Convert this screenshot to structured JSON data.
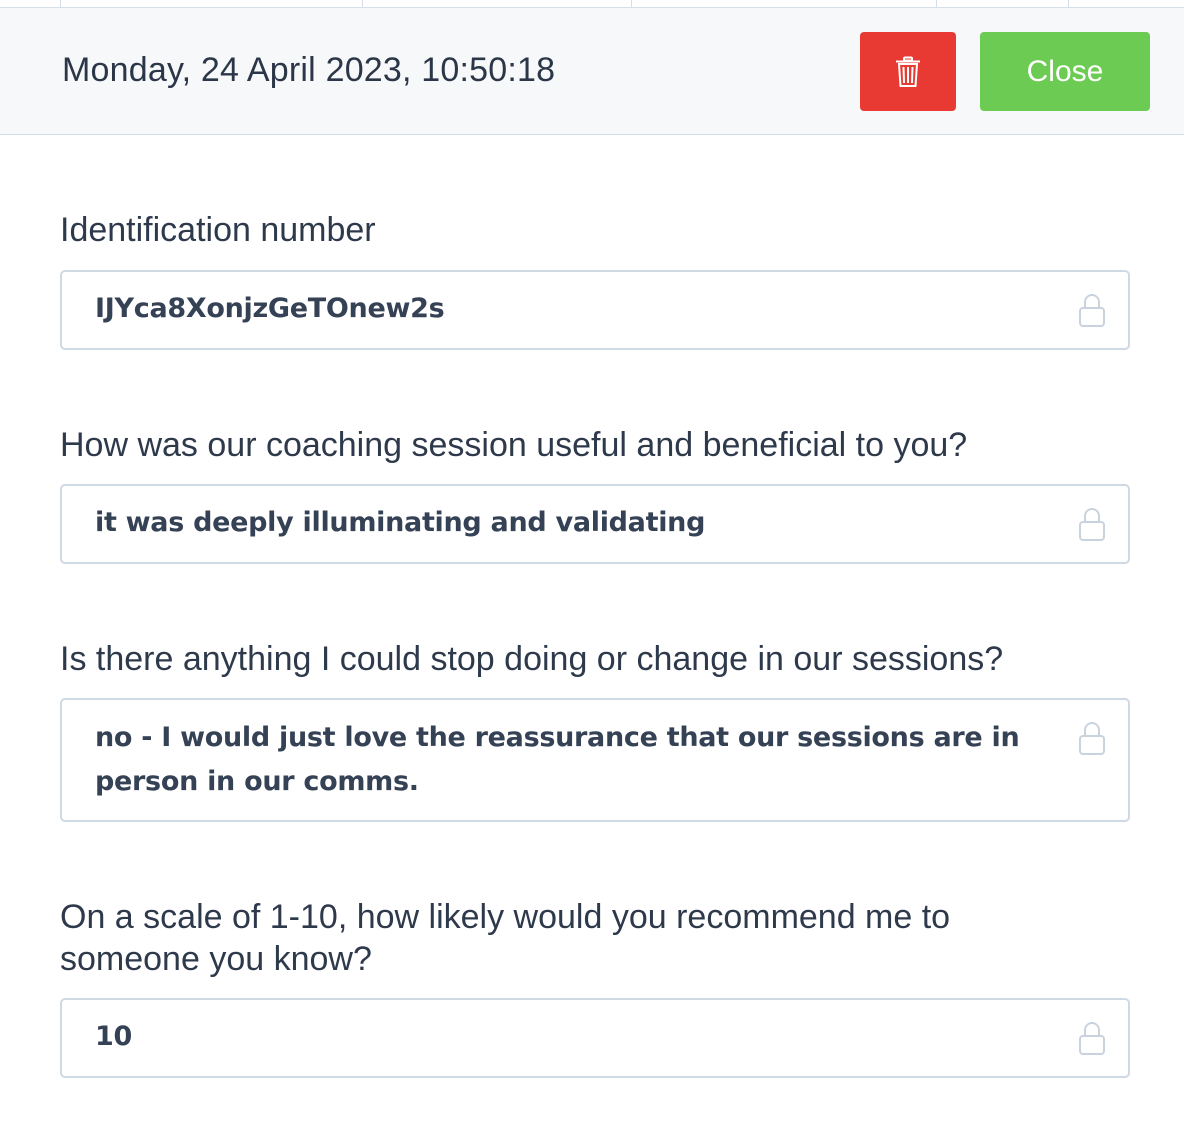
{
  "header": {
    "datetime": "Monday, 24 April 2023, 10:50:18",
    "delete_icon": "trash-icon",
    "close_label": "Close",
    "colors": {
      "delete": "#e83a32",
      "close": "#6ccb52"
    }
  },
  "fields": [
    {
      "label": "Identification number",
      "value": "IJYca8XonjzGeTOnew2s",
      "icon": "lock-icon"
    },
    {
      "label": "How was our coaching session useful and beneficial to you?",
      "value": "it was deeply illuminating and validating",
      "icon": "lock-icon"
    },
    {
      "label": "Is there anything I could stop doing or change in our sessions?",
      "value": "no - I would just love the reassurance that our sessions are in person in our comms.",
      "icon": "lock-icon"
    },
    {
      "label": "On a scale of 1-10, how likely would you recommend me to someone you know?",
      "value": "10",
      "icon": "lock-icon"
    }
  ]
}
